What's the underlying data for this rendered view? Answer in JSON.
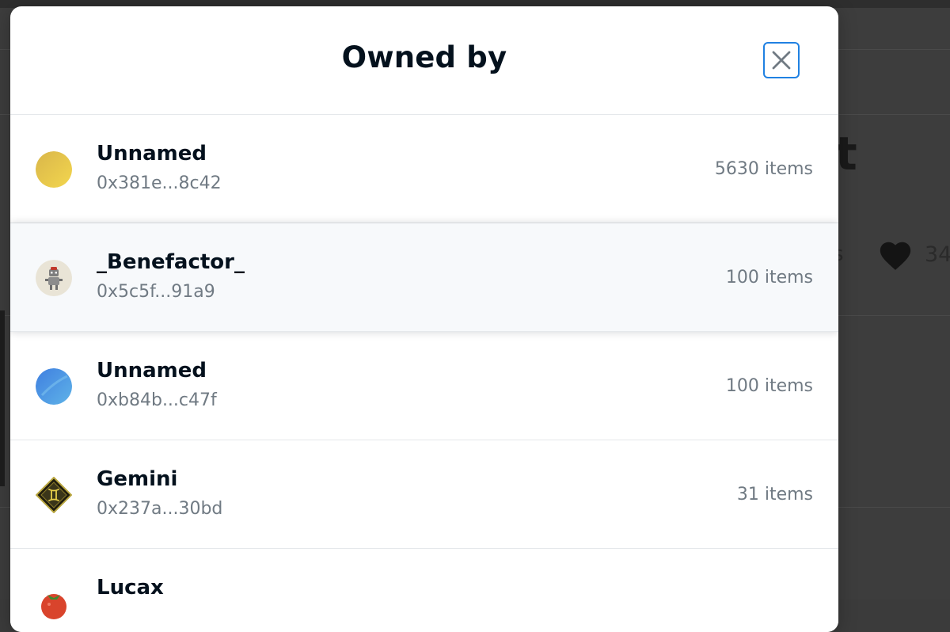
{
  "modal": {
    "title": "Owned by"
  },
  "background": {
    "title_fragment": "t",
    "stat_fragment": "s",
    "favorites_fragment": "34"
  },
  "owners": [
    {
      "name": "Unnamed",
      "address": "0x381e...8c42",
      "count": "5630 items",
      "avatar": "gold-gradient-avatar",
      "avatar_color": "#e6c243"
    },
    {
      "name": "_Benefactor_",
      "address": "0x5c5f...91a9",
      "count": "100 items",
      "avatar": "robot-avatar",
      "avatar_color": "#e9e4d6"
    },
    {
      "name": "Unnamed",
      "address": "0xb84b...c47f",
      "count": "100 items",
      "avatar": "blue-gradient-avatar",
      "avatar_color": "#3f8fe0"
    },
    {
      "name": "Gemini",
      "address": "0x237a...30bd",
      "count": "31 items",
      "avatar": "gemini-diamond-avatar",
      "avatar_color": "#2d2a14"
    },
    {
      "name": "Lucax",
      "address": "",
      "count": "",
      "avatar": "tomato-avatar",
      "avatar_color": "#d9442c"
    }
  ],
  "colors": {
    "accent": "#2081e2",
    "text_primary": "#04111d",
    "text_secondary": "#707a83",
    "hover_row": "#f7f9fb"
  }
}
